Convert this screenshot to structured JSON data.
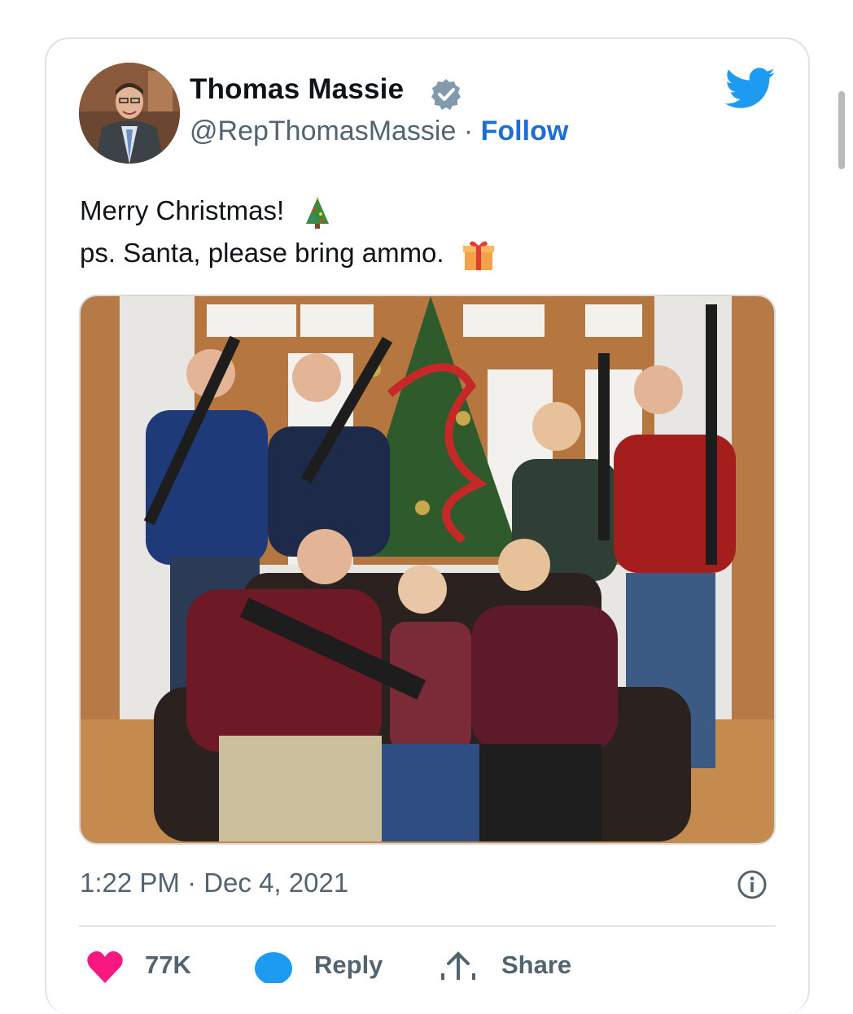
{
  "author": {
    "name": "Thomas Massie",
    "handle": "@RepThomasMassie",
    "separator": "·",
    "follow_label": "Follow"
  },
  "tweet": {
    "line1": "Merry Christmas!",
    "line2": "ps. Santa, please bring ammo.",
    "emoji1": "christmas-tree-icon",
    "emoji2": "gift-icon"
  },
  "media": {
    "description_icon": "family-christmas-photo"
  },
  "meta": {
    "timestamp": "1:22 PM · Dec 4, 2021"
  },
  "actions": {
    "like_count": "77K",
    "reply_label": "Reply",
    "share_label": "Share"
  },
  "colors": {
    "brand_blue": "#1d9bf0",
    "follow_blue": "#1d6ed4",
    "like_pink": "#f91880",
    "secondary_text": "#536471",
    "verified_gray": "#829aab"
  }
}
